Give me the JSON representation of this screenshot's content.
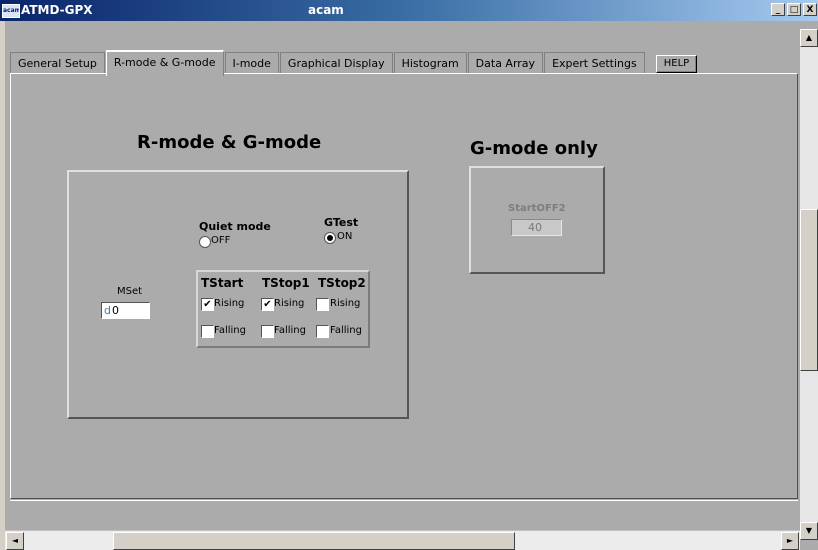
{
  "window": {
    "app_title": "ATMD-GPX",
    "center_title": "acam",
    "icon_text": "acam",
    "minimize": "_",
    "maximize": "□",
    "close": "X"
  },
  "tabs": [
    {
      "label": "General Setup"
    },
    {
      "label": "R-mode & G-mode"
    },
    {
      "label": "I-mode"
    },
    {
      "label": "Graphical Display"
    },
    {
      "label": "Histogram"
    },
    {
      "label": "Data Array"
    },
    {
      "label": "Expert Settings"
    }
  ],
  "active_tab": "R-mode & G-mode",
  "help_button": "HELP",
  "rg_section": {
    "title": "R-mode &  G-mode",
    "quiet_mode": {
      "label": "Quiet mode",
      "option_label": "OFF",
      "selected": false
    },
    "gtest": {
      "label": "GTest",
      "option_label": "ON",
      "selected": true
    },
    "mset": {
      "label": "MSet",
      "value": "0",
      "increment_glyph": "d"
    },
    "channels": [
      {
        "name": "TStart",
        "rising": true,
        "falling": false
      },
      {
        "name": "TStop1",
        "rising": true,
        "falling": false
      },
      {
        "name": "TStop2",
        "rising": false,
        "falling": false
      }
    ],
    "rising_label": "Rising",
    "falling_label": "Falling",
    "check_glyph": "✔"
  },
  "g_section": {
    "title": "G-mode only",
    "startoff2": {
      "label": "StartOFF2",
      "value": "40"
    }
  },
  "scroll": {
    "up": "▲",
    "down": "▼",
    "left": "◄",
    "right": "►"
  }
}
